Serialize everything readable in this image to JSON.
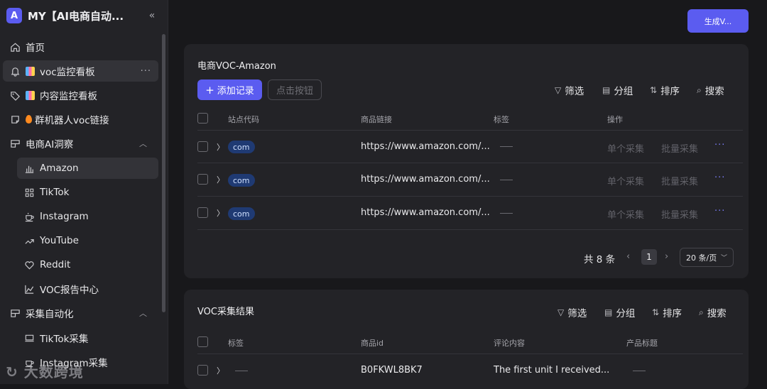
{
  "app": {
    "title": "MY【AI电商自动...",
    "logo": "A"
  },
  "sidebar": {
    "items": [
      {
        "label": "首页"
      },
      {
        "label": "voc监控看板",
        "more": "···"
      },
      {
        "label": "内容监控看板"
      },
      {
        "label": "群机器人voc链接"
      },
      {
        "label": "电商AI洞察"
      },
      {
        "label": "Amazon"
      },
      {
        "label": "TikTok"
      },
      {
        "label": "Instagram"
      },
      {
        "label": "YouTube"
      },
      {
        "label": "Reddit"
      },
      {
        "label": "VOC报告中心"
      },
      {
        "label": "采集自动化"
      },
      {
        "label": "TikTok采集"
      },
      {
        "label": "Instagram采集"
      }
    ],
    "watermark": "大数跨境"
  },
  "header": {
    "generate_label": "生成V..."
  },
  "card1": {
    "title": "电商VOC-Amazon",
    "add_label": "添加记录",
    "click_label": "点击按钮",
    "tools": {
      "filter": "筛选",
      "group": "分组",
      "sort": "排序",
      "search": "搜索"
    },
    "columns": [
      "站点代码",
      "商品链接",
      "标签",
      "操作"
    ],
    "rows": [
      {
        "site": "com",
        "link": "https://www.amazon.com/...",
        "act1": "单个采集",
        "act2": "批量采集",
        "more": "···"
      },
      {
        "site": "com",
        "link": "https://www.amazon.com/...",
        "act1": "单个采集",
        "act2": "批量采集",
        "more": "···"
      },
      {
        "site": "com",
        "link": "https://www.amazon.com/...",
        "act1": "单个采集",
        "act2": "批量采集",
        "more": "···"
      }
    ],
    "pagination": {
      "total": "共 8 条",
      "current": "1",
      "page_size": "20 条/页"
    }
  },
  "card2": {
    "title": "VOC采集结果",
    "tools": {
      "filter": "筛选",
      "group": "分组",
      "sort": "排序",
      "search": "搜索"
    },
    "columns": [
      "标签",
      "商品id",
      "评论内容",
      "产品标题"
    ],
    "rows": [
      {
        "product_id": "B0FKWL8BK7",
        "comment": "The first unit I received..."
      }
    ]
  },
  "colors": {
    "accent": "#5b5cf0",
    "pill": "#1f3a73"
  }
}
